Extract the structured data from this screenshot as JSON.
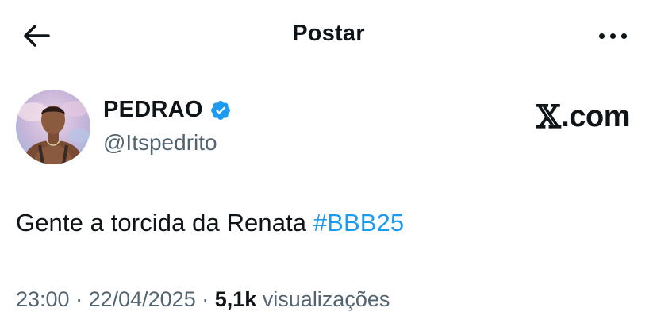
{
  "header": {
    "title": "Postar",
    "back_icon": "arrow-left-icon",
    "more_icon": "more-horizontal-icon"
  },
  "author": {
    "display_name": "PEDRAO",
    "handle": "@Itspedrito",
    "verified": true,
    "verified_color": "#1d9bf0"
  },
  "watermark": {
    "x_mark": "𝕏",
    "text": ".com"
  },
  "tweet": {
    "text_before": "Gente a torcida da Renata ",
    "hashtag": "#BBB25",
    "hashtag_color": "#1d9bf0"
  },
  "meta": {
    "time": "23:00",
    "separator": " · ",
    "date": "22/04/2025",
    "views_count": "5,1k",
    "views_label": " visualizações"
  }
}
